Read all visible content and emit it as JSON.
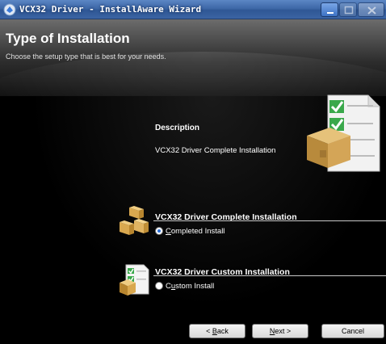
{
  "window": {
    "title": "VCX32 Driver - InstallAware Wizard",
    "controls": [
      "minimize-icon",
      "maximize-icon",
      "close-icon"
    ]
  },
  "header": {
    "title": "Type of Installation",
    "subtitle": "Choose the setup type that is best for your needs."
  },
  "description": {
    "heading": "Description",
    "text": "VCX32 Driver Complete Installation",
    "art_icon": "box-with-checklist-icon"
  },
  "options": [
    {
      "title": "VCX32 Driver Complete Installation",
      "radio_label_prefix": "",
      "radio_label_access": "C",
      "radio_label_rest": "ompleted Install",
      "selected": true,
      "icon": "boxes-icon"
    },
    {
      "title": "VCX32 Driver Custom Installation",
      "radio_label_prefix": "C",
      "radio_label_access": "u",
      "radio_label_rest": "stom Install",
      "selected": false,
      "icon": "custom-package-icon"
    }
  ],
  "buttons": {
    "back_prefix": "< ",
    "back_access": "B",
    "back_rest": "ack",
    "next_access": "N",
    "next_rest": "ext >",
    "cancel": "Cancel"
  }
}
